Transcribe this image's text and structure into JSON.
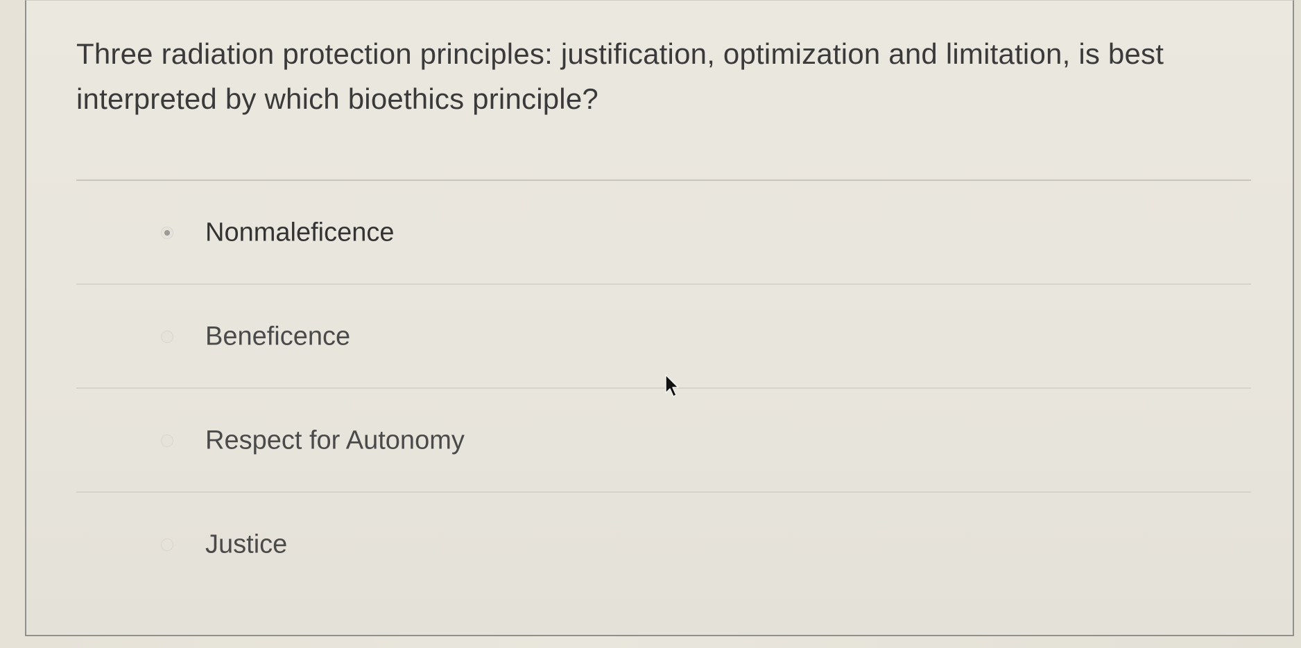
{
  "question": {
    "text": "Three radiation protection principles: justification, optimization and limitation, is best interpreted by which bioethics principle?"
  },
  "answers": [
    {
      "label": "Nonmaleficence"
    },
    {
      "label": "Beneficence"
    },
    {
      "label": "Respect for Autonomy"
    },
    {
      "label": "Justice"
    }
  ]
}
